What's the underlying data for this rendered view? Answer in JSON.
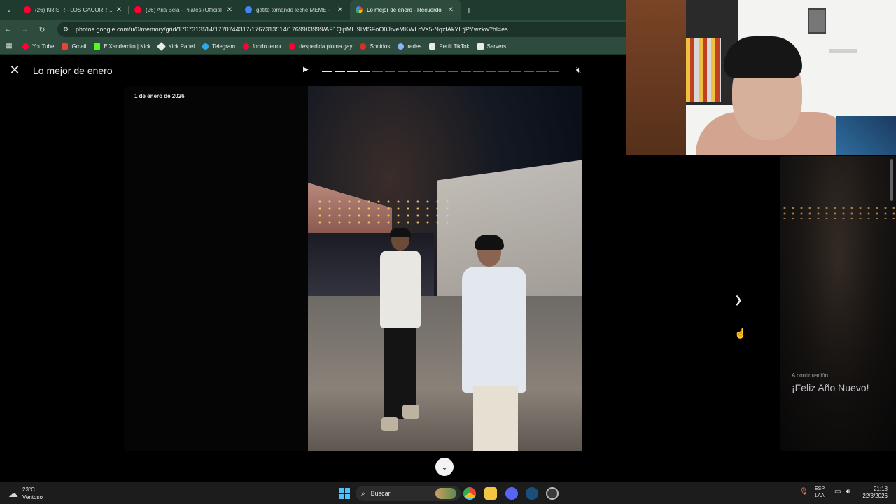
{
  "browser": {
    "tabs": [
      {
        "title": "(26) KRIS R - LOS CACORROS",
        "favicon_color": "#ff0033"
      },
      {
        "title": "(26) Aria Bela - Pilates (Official",
        "favicon_color": "#ff0033"
      },
      {
        "title": "gatito tomando leche MEME -",
        "favicon_color": "#4285f4"
      },
      {
        "title": "Lo mejor de enero - Recuerdo",
        "favicon_color": "#fbbc04"
      }
    ],
    "url": "photos.google.com/u/0/memory/grid/1767313514/1770744317/1767313514/1769903999/AF1QipMLI9IMSFoO0JrveMKWLcVs5-NqzfAkYLfjPYwzkw?hl=es",
    "bookmarks": [
      {
        "label": "YouTube",
        "color": "#ff0033"
      },
      {
        "label": "Gmail",
        "color": "#ea4335"
      },
      {
        "label": "ElXandercito | Kick",
        "color": "#53fc18"
      },
      {
        "label": "Kick Panel",
        "color": "#e8eaed"
      },
      {
        "label": "Telegram",
        "color": "#2aabee"
      },
      {
        "label": "fondo terror",
        "color": "#ff0033"
      },
      {
        "label": "despedida pluma gay",
        "color": "#ff0033"
      },
      {
        "label": "Sonidos",
        "color": "#d93025"
      },
      {
        "label": "redes",
        "color": "#8ab4f8"
      },
      {
        "label": "Perfil TikTok",
        "color": "#e8eaed"
      },
      {
        "label": "Servers",
        "color": "#e8eaed"
      }
    ]
  },
  "viewer": {
    "title": "Lo mejor de enero",
    "date": "1 de enero de 2026",
    "progress": {
      "total": 19,
      "completed": 4
    },
    "up_next_label": "A continuación",
    "up_next_title": "¡Feliz Año Nuevo!"
  },
  "taskbar": {
    "temp": "23°C",
    "condition": "Ventoso",
    "search_placeholder": "Buscar",
    "lang_line1": "ESP",
    "lang_line2": "LAA",
    "time": "21:18",
    "date": "22/3/2026"
  }
}
